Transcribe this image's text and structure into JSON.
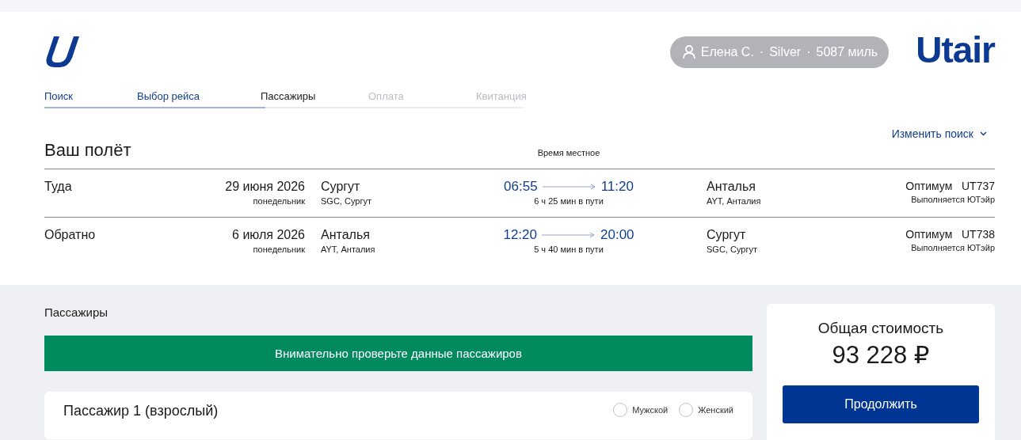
{
  "header": {
    "account": {
      "parts": [
        "Елена С.",
        "·",
        "Silver",
        "·",
        "5087 миль"
      ]
    },
    "brand": "Utair"
  },
  "steps": {
    "level": 0.46,
    "items": [
      {
        "label": "Поиск",
        "done": true,
        "selected": false
      },
      {
        "label": "Выбор рейса",
        "done": true,
        "selected": false
      },
      {
        "label": "Пассажиры",
        "done": false,
        "selected": true
      },
      {
        "label": "Оплата",
        "done": false,
        "selected": false
      },
      {
        "label": "Квитанция",
        "done": false,
        "selected": false
      }
    ]
  },
  "change_search": "Изменить поиск",
  "flight": {
    "title": "Ваш полёт",
    "time_note": "Время местное",
    "legs": [
      {
        "direction": "Туда",
        "date": "29 июня 2026",
        "weekday": "понедельник",
        "from_city": "Сургут",
        "from_airport": "SGC, Сургут",
        "depart": "06:55",
        "arrive": "11:20",
        "duration": "6 ч 25 мин в пути",
        "to_city": "Анталья",
        "to_airport": "AYT, Анталия",
        "fare": "Оптимум",
        "flight_no": "UT737",
        "operator": "Выполняется ЮТэйр"
      },
      {
        "direction": "Обратно",
        "date": "6 июля 2026",
        "weekday": "понедельник",
        "from_city": "Анталья",
        "from_airport": "AYT, Анталия",
        "depart": "12:20",
        "arrive": "20:00",
        "duration": "5 ч 40 мин в пути",
        "to_city": "Сургут",
        "to_airport": "SGC, Сургут",
        "fare": "Оптимум",
        "flight_no": "UT738",
        "operator": "Выполняется ЮТэйр"
      }
    ]
  },
  "passengers": {
    "title": "Пассажиры",
    "notice": "Внимательно проверьте данные пассажиров",
    "cards": [
      {
        "title": "Пассажир 1 (взрослый)",
        "gender": [
          {
            "label": "Мужской",
            "selected": false
          },
          {
            "label": "Женский",
            "selected": false
          }
        ]
      }
    ]
  },
  "summary": {
    "title": "Общая стоимость",
    "total": "93 228 ₽",
    "button": "Продолжить"
  }
}
